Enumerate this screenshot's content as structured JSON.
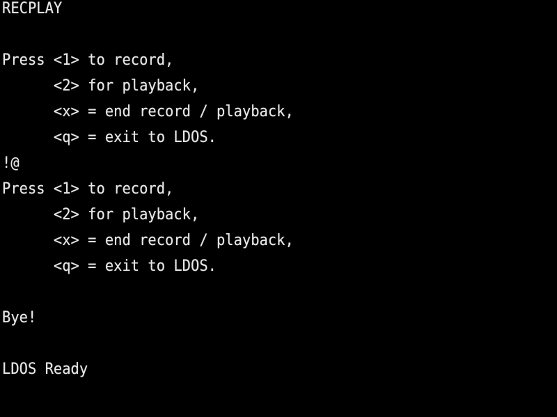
{
  "screen": {
    "text_color": "#e8e8e8",
    "background_color": "#000000",
    "lines": [
      "RECPLAY",
      "",
      "Press <1> to record,",
      "      <2> for playback,",
      "      <x> = end record / playback,",
      "      <q> = exit to LDOS.",
      "!@",
      "Press <1> to record,",
      "      <2> for playback,",
      "      <x> = end record / playback,",
      "      <q> = exit to LDOS.",
      "",
      "Bye!",
      "",
      "LDOS Ready"
    ]
  }
}
